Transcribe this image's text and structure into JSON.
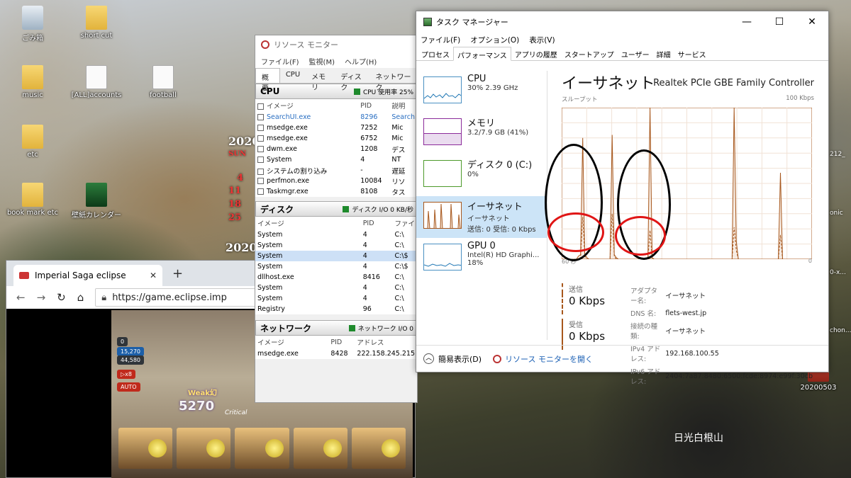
{
  "desktop": {
    "icons": [
      {
        "label": "ごみ箱",
        "kind": "bin"
      },
      {
        "label": "short cut",
        "kind": "doc"
      },
      {
        "label": "music",
        "kind": "folder"
      },
      {
        "label": "[ALL]accounts",
        "kind": "doc"
      },
      {
        "label": "football",
        "kind": "doc"
      },
      {
        "label": "etc",
        "kind": "folder"
      },
      {
        "label": "book mark etc",
        "kind": "folder"
      },
      {
        "label": "壁紙カレンダー",
        "kind": "app"
      },
      {
        "label": "20200503",
        "kind": "cal"
      }
    ],
    "calendar_year": "2020",
    "calendar_month": "SUN",
    "calendar_days": [
      "4",
      "11",
      "18",
      "25"
    ],
    "calendar_year2": "2020",
    "mountain_label": "日光白根山",
    "right_labels": [
      "212_",
      "onic",
      "0-x...",
      "chon..."
    ]
  },
  "browser": {
    "tab_title": "Imperial Saga eclipse",
    "url": "https://game.eclipse.imp",
    "game": {
      "hud_values": [
        "0",
        "15,270",
        "44,580"
      ],
      "buttons": [
        "▷x8",
        "AUTO"
      ],
      "week_text": "Weak幻",
      "damage": "5270",
      "critical_text": "Critical"
    }
  },
  "resource_monitor": {
    "title": "リソース モニター",
    "menu": [
      "ファイル(F)",
      "監視(M)",
      "ヘルプ(H)"
    ],
    "tabs": [
      "概要",
      "CPU",
      "メモリ",
      "ディスク",
      "ネットワーク"
    ],
    "cpu": {
      "heading": "CPU",
      "meter": "CPU 使用率 25%",
      "columns": [
        "イメージ",
        "PID",
        "説明"
      ],
      "rows": [
        {
          "image": "SearchUI.exe",
          "pid": "8296",
          "desc": "Search"
        },
        {
          "image": "msedge.exe",
          "pid": "7252",
          "desc": "Mic"
        },
        {
          "image": "msedge.exe",
          "pid": "6752",
          "desc": "Mic"
        },
        {
          "image": "dwm.exe",
          "pid": "1208",
          "desc": "デス"
        },
        {
          "image": "System",
          "pid": "4",
          "desc": "NT"
        },
        {
          "image": "システムの割り込み",
          "pid": "-",
          "desc": "遅延"
        },
        {
          "image": "perfmon.exe",
          "pid": "10084",
          "desc": "リソ"
        },
        {
          "image": "Taskmgr.exe",
          "pid": "8108",
          "desc": "タス"
        }
      ]
    },
    "disk": {
      "heading": "ディスク",
      "meter": "ディスク I/O 0 KB/秒",
      "columns": [
        "イメージ",
        "PID",
        "ファイ"
      ],
      "rows": [
        {
          "image": "System",
          "pid": "4",
          "file": "C:\\"
        },
        {
          "image": "System",
          "pid": "4",
          "file": "C:\\"
        },
        {
          "image": "System",
          "pid": "4",
          "file": "C:\\$"
        },
        {
          "image": "System",
          "pid": "4",
          "file": "C:\\$"
        },
        {
          "image": "dllhost.exe",
          "pid": "8416",
          "file": "C:\\"
        },
        {
          "image": "System",
          "pid": "4",
          "file": "C:\\"
        },
        {
          "image": "System",
          "pid": "4",
          "file": "C:\\"
        },
        {
          "image": "Registry",
          "pid": "96",
          "file": "C:\\"
        }
      ]
    },
    "network": {
      "heading": "ネットワーク",
      "meter": "ネットワーク I/O 0",
      "columns": [
        "イメージ",
        "PID",
        "アドレス"
      ],
      "rows": [
        {
          "image": "msedge.exe",
          "pid": "8428",
          "addr": "222.158.245.215"
        }
      ]
    }
  },
  "task_manager": {
    "title": "タスク マネージャー",
    "menu": [
      "ファイル(F)",
      "オプション(O)",
      "表示(V)"
    ],
    "tabs": [
      "プロセス",
      "パフォーマンス",
      "アプリの履歴",
      "スタートアップ",
      "ユーザー",
      "詳細",
      "サービス"
    ],
    "resources": [
      {
        "name": "CPU",
        "line1": "30%  2.39 GHz",
        "line2": "",
        "color": "#1f77b4"
      },
      {
        "name": "メモリ",
        "line1": "3.2/7.9 GB (41%)",
        "line2": "",
        "color": "#8b2b9a"
      },
      {
        "name": "ディスク 0 (C:)",
        "line1": "0%",
        "line2": "",
        "color": "#4d9a2a"
      },
      {
        "name": "イーサネット",
        "line1": "イーサネット",
        "line2": "送信: 0 受信: 0 Kbps",
        "color": "#a7571c"
      },
      {
        "name": "GPU 0",
        "line1": "Intel(R) HD Graphi...",
        "line2": "18%",
        "color": "#1f77b4"
      }
    ],
    "ethernet": {
      "title": "イーサネット",
      "adapter": "Realtek PCIe GBE Family Controller",
      "throughput_label": "スループット",
      "max_label": "100 Kbps",
      "time_label": "60 秒",
      "min_label": "0",
      "send_label": "送信",
      "send_value": "0 Kbps",
      "recv_label": "受信",
      "recv_value": "0 Kbps",
      "details": [
        {
          "key": "アダプター名:",
          "value": "イーサネット"
        },
        {
          "key": "DNS 名:",
          "value": "flets-west.jp"
        },
        {
          "key": "接続の種類:",
          "value": "イーサネット"
        },
        {
          "key": "IPv4 アドレス:",
          "value": "192.168.100.55"
        },
        {
          "key": "IPv6 アドレス:",
          "value": "2404:7a87:8480:6500:fcde:8974:e99f:30cb"
        }
      ],
      "recv_series": [
        0,
        0,
        0,
        0,
        0,
        0,
        0,
        0,
        2,
        3,
        80,
        3,
        1,
        0,
        0,
        0,
        0,
        0,
        0,
        0,
        0,
        0,
        0,
        0,
        82,
        3,
        1,
        0,
        0,
        0,
        0,
        0,
        0,
        0,
        0,
        0,
        0,
        0,
        0,
        0,
        0,
        0,
        100,
        1,
        0,
        0,
        0,
        0,
        0,
        0,
        0,
        0,
        0,
        0,
        0,
        0,
        0,
        0,
        0,
        0,
        0,
        0,
        0,
        0,
        0,
        0,
        0,
        0,
        0,
        0,
        0,
        0,
        0,
        0,
        0,
        0,
        0,
        0,
        0,
        0,
        0,
        0,
        100,
        12,
        0,
        0,
        0,
        0,
        0,
        0,
        0,
        0,
        0,
        0,
        0,
        0,
        0,
        0,
        0,
        0,
        0,
        0,
        0,
        0,
        57,
        0,
        0,
        0,
        0,
        0,
        0,
        0,
        0,
        0,
        0,
        0,
        0,
        0,
        0,
        0
      ],
      "send_series": [
        0,
        0,
        0,
        0,
        0,
        0,
        0,
        0,
        0,
        1,
        28,
        2,
        0,
        0,
        0,
        0,
        0,
        0,
        0,
        0,
        0,
        0,
        0,
        0,
        30,
        2,
        0,
        0,
        0,
        0,
        0,
        0,
        0,
        0,
        0,
        0,
        0,
        0,
        0,
        0,
        0,
        0,
        19,
        0,
        0,
        0,
        0,
        0,
        0,
        0,
        0,
        0,
        0,
        0,
        0,
        0,
        0,
        0,
        0,
        0,
        0,
        0,
        0,
        0,
        0,
        0,
        0,
        0,
        0,
        0,
        0,
        0,
        0,
        0,
        0,
        0,
        0,
        0,
        0,
        0,
        0,
        0,
        21,
        6,
        0,
        0,
        0,
        0,
        0,
        0,
        0,
        0,
        0,
        0,
        0,
        0,
        0,
        0,
        0,
        0,
        0,
        0,
        0,
        0,
        16,
        0,
        0,
        0,
        0,
        0,
        0,
        0,
        0,
        0,
        0,
        0,
        0,
        0,
        0,
        0
      ]
    },
    "footer": {
      "collapse_label": "簡易表示(D)",
      "open_resmon": "リソース モニターを開く"
    }
  }
}
